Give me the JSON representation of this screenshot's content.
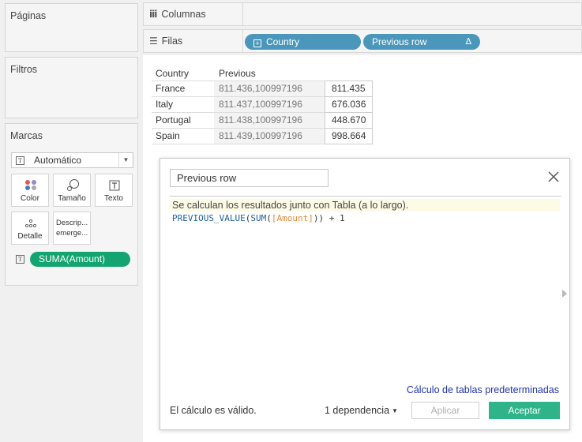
{
  "left_panel": {
    "paginas_title": "Páginas",
    "filtros_title": "Filtros",
    "marcas_title": "Marcas",
    "mark_type": {
      "icon": "T",
      "value": "Automático"
    },
    "mark_buttons": {
      "color": "Color",
      "tamano": "Tamaño",
      "texto": "Texto",
      "detalle": "Detalle",
      "descrip_line1": "Descrip...",
      "descrip_line2": "emerge..."
    },
    "mark_pill": {
      "icon": "T",
      "label": "SUMA(Amount)"
    }
  },
  "shelves": {
    "columnas_label": "Columnas",
    "filas_label": "Filas",
    "filas_pills": [
      {
        "label": "Country",
        "prefix_icon": "plus-box-icon"
      },
      {
        "label": "Previous row",
        "suffix": "Δ"
      }
    ]
  },
  "view_table": {
    "headers": [
      "Country",
      "Previous row"
    ],
    "rows": [
      {
        "country": "France",
        "previous": "811.436,100997196",
        "amount": "811.435"
      },
      {
        "country": "Italy",
        "previous": "811.437,100997196",
        "amount": "676.036"
      },
      {
        "country": "Portugal",
        "previous": "811.438,100997196",
        "amount": "448.670"
      },
      {
        "country": "Spain",
        "previous": "811.439,100997196",
        "amount": "998.664"
      }
    ]
  },
  "calc_dialog": {
    "name": "Previous row",
    "note": "Se calculan los resultados junto con Tabla (a lo largo).",
    "formula": {
      "fn1": "PREVIOUS_VALUE",
      "p1": "(",
      "fn2": "SUM",
      "p2": "(",
      "field": "[Amount]",
      "rest": ")) + 1"
    },
    "default_link": "Cálculo de tablas predeterminadas",
    "status": "El cálculo es válido.",
    "dependency": "1 dependencia",
    "apply_label": "Aplicar",
    "ok_label": "Aceptar"
  },
  "colors": {
    "blue_pill": "#4b97bb",
    "green_pill": "#13a472",
    "ok_button": "#2fb48a",
    "link": "#2234a8"
  }
}
